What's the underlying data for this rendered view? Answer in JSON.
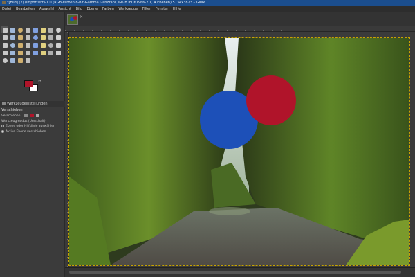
{
  "window": {
    "title": "*[Bild] (2) (importiert)-1.0 (RGB-Farben 8-Bit-Gamma Ganzzahl, sRGB IEC61966-2.1, 4 Ebenen) 5734x3823 – GIMP"
  },
  "menu": [
    "Datei",
    "Bearbeiten",
    "Auswahl",
    "Ansicht",
    "Bild",
    "Ebene",
    "Farben",
    "Werkzeuge",
    "Filter",
    "Fenster",
    "Hilfe"
  ],
  "toolbox": {
    "tools": [
      "move-tool",
      "rect-select-tool",
      "ellipse-select-tool",
      "free-select-tool",
      "fuzzy-select-tool",
      "crop-tool",
      "align-tool",
      "color-picker-tool",
      "unified-transform-tool",
      "warp-tool",
      "handle-transform-tool",
      "flip-tool",
      "cage-tool",
      "perspective-tool",
      "measure-tool",
      "zoom-tool",
      "paths-tool",
      "text-tool",
      "bucket-fill-tool",
      "gradient-tool",
      "paintbrush-tool",
      "pencil-tool",
      "airbrush-tool",
      "ink-tool",
      "mypaint-tool",
      "clone-tool",
      "heal-tool",
      "smudge-tool",
      "blur-tool",
      "dodge-burn-tool",
      "eraser-tool",
      "foreground-select-tool",
      "scissors-tool",
      "color-tool",
      "levels-tool",
      "curves-tool"
    ],
    "fg_color": "#b0142a",
    "bg_color": "#ffffff"
  },
  "dock": {
    "tab_label": "Werkzeugeinstellungen",
    "panel_title": "Verschieben",
    "row1": "Verschieben:",
    "section": "Werkzeugmodus (Umschalt)",
    "option1": "Ebene oder Hilfslinie auswählen",
    "option2": "Aktive Ebene verschieben"
  },
  "canvas": {
    "circle_blue": "#1d50b8",
    "circle_red": "#b0142a"
  }
}
